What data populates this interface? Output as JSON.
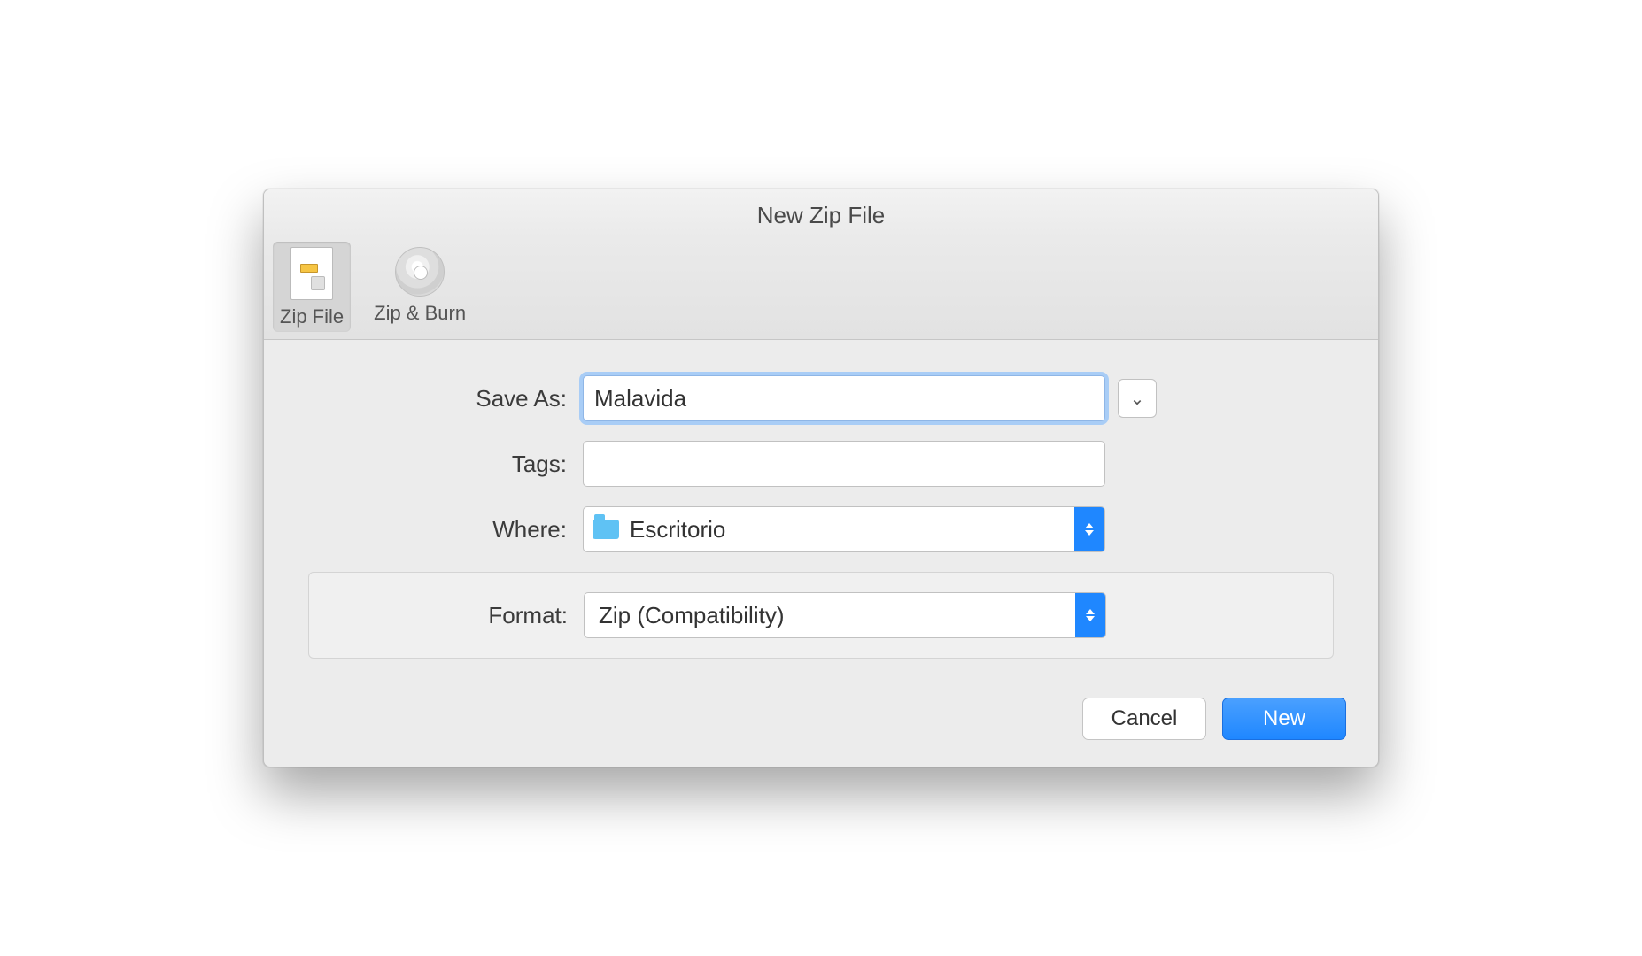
{
  "window": {
    "title": "New Zip File"
  },
  "toolbar": {
    "zip_file_label": "Zip File",
    "zip_burn_label": "Zip & Burn"
  },
  "form": {
    "save_as_label": "Save As:",
    "save_as_value": "Malavida",
    "tags_label": "Tags:",
    "tags_value": "",
    "where_label": "Where:",
    "where_value": "Escritorio",
    "format_label": "Format:",
    "format_value": "Zip (Compatibility)"
  },
  "buttons": {
    "cancel": "Cancel",
    "new": "New"
  }
}
